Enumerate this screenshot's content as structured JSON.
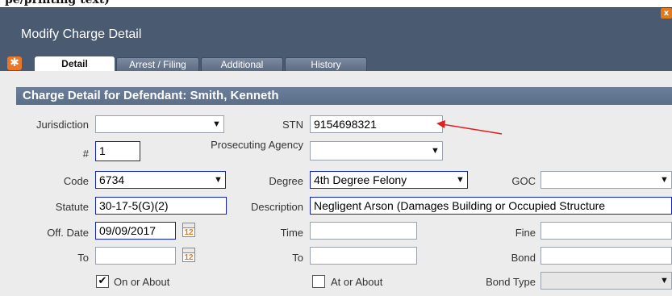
{
  "page_top_text": "pe/printing text)",
  "window": {
    "title": "Modify Charge Detail",
    "close_glyph": "x"
  },
  "tabs": [
    {
      "label": "Detail",
      "active": true
    },
    {
      "label": "Arrest / Filing",
      "active": false
    },
    {
      "label": "Additional",
      "active": false
    },
    {
      "label": "History",
      "active": false
    }
  ],
  "section": {
    "header": "Charge Detail for Defendant: Smith, Kenneth"
  },
  "form": {
    "jurisdiction": {
      "label": "Jurisdiction",
      "value": ""
    },
    "stn": {
      "label": "STN",
      "value": "9154698321"
    },
    "number": {
      "label": "#",
      "value": "1"
    },
    "prosecuting_agency": {
      "label": "Prosecuting Agency",
      "value": ""
    },
    "code": {
      "label": "Code",
      "value": "6734"
    },
    "degree": {
      "label": "Degree",
      "value": "4th Degree Felony"
    },
    "goc": {
      "label": "GOC",
      "value": ""
    },
    "statute": {
      "label": "Statute",
      "value": "30-17-5(G)(2)"
    },
    "description": {
      "label": "Description",
      "value": "Negligent Arson (Damages Building or Occupied Structure"
    },
    "off_date": {
      "label": "Off. Date",
      "value": "09/09/2017"
    },
    "time": {
      "label": "Time",
      "value": ""
    },
    "fine": {
      "label": "Fine",
      "value": ""
    },
    "to1": {
      "label": "To",
      "value": ""
    },
    "to2": {
      "label": "To",
      "value": ""
    },
    "bond": {
      "label": "Bond",
      "value": ""
    },
    "on_or_about": {
      "label": "On or About",
      "checked": true
    },
    "at_or_about": {
      "label": "At or About",
      "checked": false
    },
    "bond_type": {
      "label": "Bond Type",
      "value": ""
    }
  },
  "calendar_glyph": "12",
  "colors": {
    "titlebar": "#4a5a70",
    "section_header": "#5a6e8a",
    "accent_orange": "#e07a1c",
    "annotation_arrow": "#e02020"
  }
}
